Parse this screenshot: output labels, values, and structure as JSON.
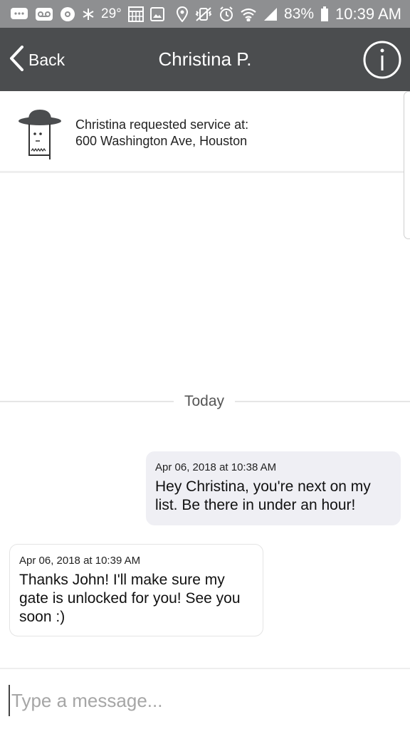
{
  "status_bar": {
    "icons": [
      "messages-icon",
      "voicemail-icon",
      "settings-cog-icon",
      "snowflake-icon",
      "calendar-icon",
      "gallery-icon",
      "location-icon",
      "mute-vibrate-icon",
      "alarm-icon",
      "wifi-icon",
      "signal-icon",
      "battery-icon"
    ],
    "temperature": "29°",
    "battery": "83%",
    "time": "10:39 AM"
  },
  "nav": {
    "back_label": "Back",
    "title": "Christina P.",
    "info_icon": "info-icon"
  },
  "service": {
    "avatar_icon": "hat-person-icon",
    "line1": "Christina requested service at:",
    "line2": "600 Washington Ave, Houston"
  },
  "divider": {
    "label": "Today"
  },
  "messages": [
    {
      "direction": "outgoing",
      "timestamp": "Apr 06, 2018 at 10:38 AM",
      "text": "Hey Christina, you're next on my list. Be there in under an hour!"
    },
    {
      "direction": "incoming",
      "timestamp": "Apr 06, 2018 at 10:39 AM",
      "text": "Thanks John! I'll make sure my gate is unlocked for you! See you soon :)"
    }
  ],
  "composer": {
    "placeholder": "Type a message...",
    "value": ""
  },
  "colors": {
    "status_bar": "#8e8f91",
    "nav_bar": "#4b4d4f",
    "outgoing_bubble": "#efeff4",
    "incoming_bubble": "#ffffff"
  }
}
